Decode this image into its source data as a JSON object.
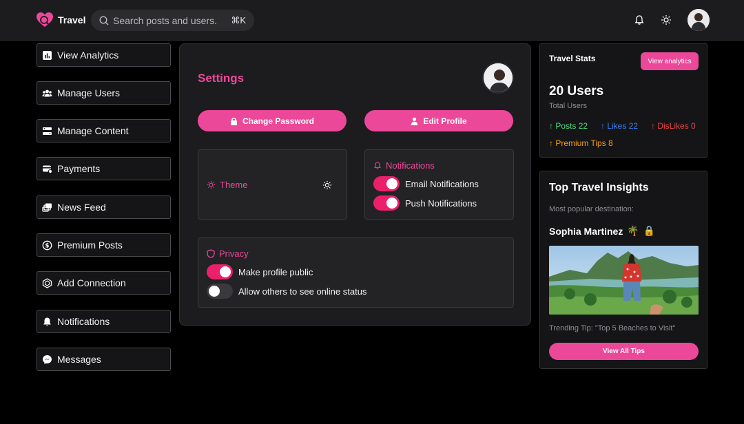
{
  "header": {
    "brand": "Travel",
    "search_placeholder": "Search posts and users...",
    "shortcut": "⌘K"
  },
  "sidebar": {
    "items": [
      {
        "label": "View Analytics",
        "icon": "analytics-icon"
      },
      {
        "label": "Manage Users",
        "icon": "users-icon"
      },
      {
        "label": "Manage Content",
        "icon": "content-icon"
      },
      {
        "label": "Payments",
        "icon": "payments-icon"
      },
      {
        "label": "News Feed",
        "icon": "news-feed-icon"
      },
      {
        "label": "Premium Posts",
        "icon": "premium-icon"
      },
      {
        "label": "Add Connection",
        "icon": "connection-icon"
      },
      {
        "label": "Notifications",
        "icon": "bell-icon"
      },
      {
        "label": "Messages",
        "icon": "messenger-icon"
      }
    ]
  },
  "settings": {
    "title": "Settings",
    "change_password": "Change Password",
    "edit_profile": "Edit Profile",
    "theme_label": "Theme",
    "notifications": {
      "title": "Notifications",
      "email": "Email Notifications",
      "email_on": true,
      "push": "Push Notifications",
      "push_on": true
    },
    "privacy": {
      "title": "Privacy",
      "public_profile": "Make profile public",
      "public_profile_on": true,
      "online_status": "Allow others to see online status",
      "online_status_on": false
    }
  },
  "stats": {
    "title": "Travel Stats",
    "view_analytics": "View analytics",
    "users_count": "20 Users",
    "users_caption": "Total Users",
    "posts": "Posts 22",
    "likes": "Likes 22",
    "dislikes": "DisLikes 0",
    "premium_tips": "Premium Tips 8"
  },
  "insights": {
    "title": "Top Travel Insights",
    "subtitle": "Most popular destination:",
    "name": "Sophia Martinez",
    "emoji1": "🌴",
    "emoji2": "🔒",
    "tip": "Trending Tip: \"Top 5 Beaches to Visit\"",
    "button": "View All Tips"
  },
  "colors": {
    "accent": "#ec4899",
    "green": "#4ade80",
    "blue": "#3b82f6",
    "red": "#ef4444",
    "amber": "#f59e0b"
  }
}
